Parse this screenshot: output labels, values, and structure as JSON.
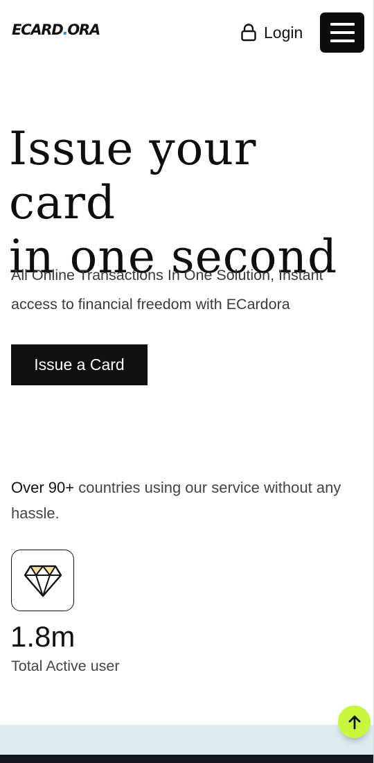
{
  "header": {
    "logo_main": "ECARD",
    "logo_dot": ".",
    "logo_tail": "ORA",
    "login_label": "Login"
  },
  "hero": {
    "title_line1": "Issue your card",
    "title_line2": "in one second",
    "subtitle": "All Online Transactions In One Solution, Instant access to financial freedom with ECardora",
    "cta_label": "Issue a Card"
  },
  "stats": {
    "countries_strong": "Over 90+",
    "countries_rest": " countries using our service without any hassle.",
    "active_users_value": "1.8m",
    "active_users_label": "Total Active user"
  },
  "icons": {
    "login": "lock-icon",
    "menu": "hamburger-icon",
    "stat": "diamond-icon",
    "scroll": "arrow-up-icon"
  },
  "colors": {
    "accent_scroll": "#c8f83e",
    "logo_dot": "#2f7de1",
    "band": "#dcedf1",
    "primary_dark": "#111111"
  }
}
